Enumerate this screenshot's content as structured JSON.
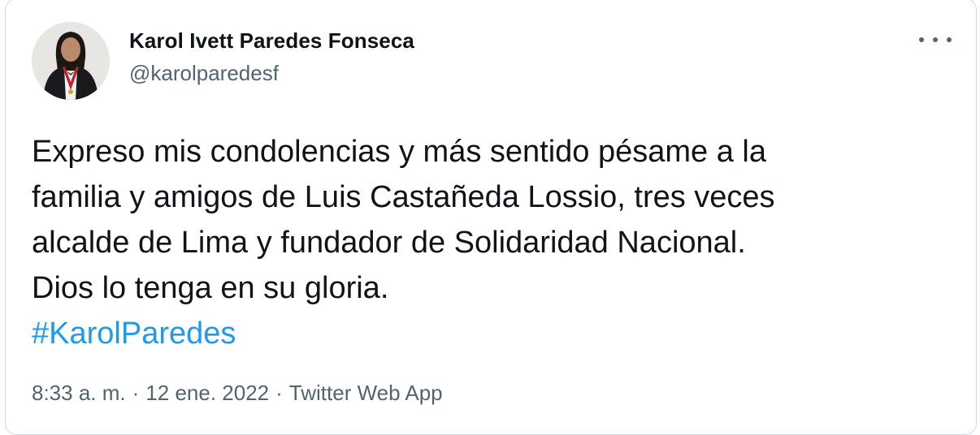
{
  "author": {
    "name": "Karol Ivett Paredes Fonseca",
    "handle": "@karolparedesf"
  },
  "tweet": {
    "lines": [
      "Expreso mis condolencias y más sentido pésame a la",
      "familia y amigos de Luis Castañeda Lossio, tres veces",
      "alcalde de Lima y fundador de Solidaridad Nacional.",
      "Dios lo tenga en su gloria."
    ],
    "hashtag": "#KarolParedes"
  },
  "meta": {
    "time": "8:33 a. m.",
    "separator": "·",
    "date": "12 ene. 2022",
    "source": "Twitter Web App"
  },
  "icons": {
    "more": "more-horizontal-icon"
  },
  "colors": {
    "text": "#0f1419",
    "secondary": "#536471",
    "link": "#1d9bf0",
    "border": "#cfd9de"
  }
}
